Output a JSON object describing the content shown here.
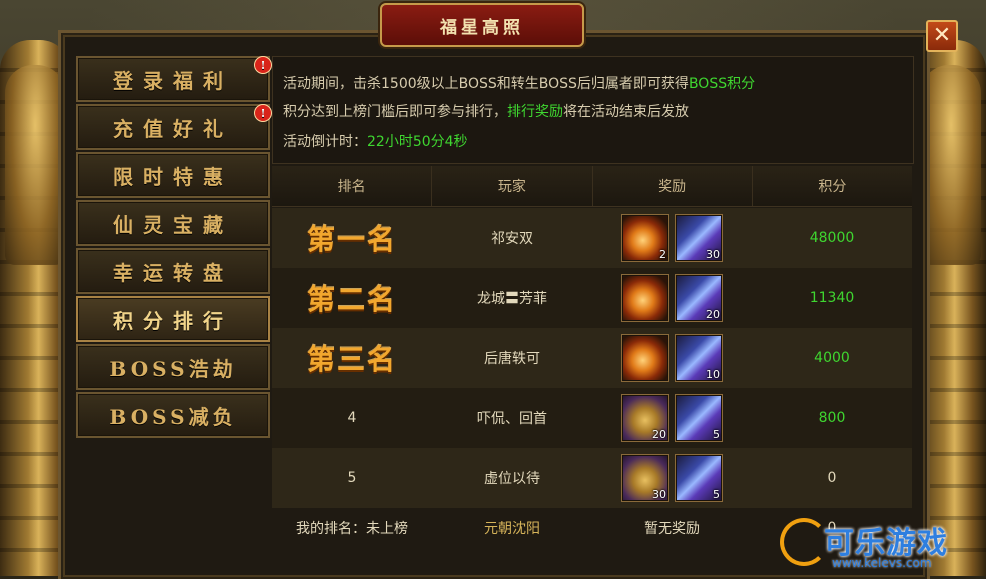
{
  "window": {
    "title": "福星高照",
    "close_icon": "✕"
  },
  "sidebar": {
    "items": [
      {
        "label": "登录福利",
        "badge": "!",
        "active": false
      },
      {
        "label": "充值好礼",
        "badge": "!",
        "active": false
      },
      {
        "label": "限时特惠",
        "badge": "",
        "active": false
      },
      {
        "label": "仙灵宝藏",
        "badge": "",
        "active": false
      },
      {
        "label": "幸运转盘",
        "badge": "",
        "active": false
      },
      {
        "label": "积分排行",
        "badge": "",
        "active": true
      },
      {
        "label": "BOSS浩劫",
        "badge": "",
        "active": false
      },
      {
        "label": "BOSS减负",
        "badge": "",
        "active": false
      }
    ]
  },
  "info": {
    "line1_prefix": "活动期间，击杀1500级以上BOSS和转生BOSS后归属者即可获得",
    "line1_highlight": "BOSS积分",
    "line2_prefix": "积分达到上榜门槛后即可参与排行，",
    "line2_highlight": "排行奖励",
    "line2_suffix": "将在活动结束后发放",
    "countdown_label": "活动倒计时：",
    "countdown_value": "22小时50分4秒"
  },
  "table": {
    "headers": [
      "排名",
      "玩家",
      "奖励",
      "积分"
    ],
    "rows": [
      {
        "rank": "第一名",
        "player": "祁安双",
        "rewards": [
          {
            "type": "potion",
            "qty": "2"
          },
          {
            "type": "shard",
            "qty": "30"
          }
        ],
        "score": "48000"
      },
      {
        "rank": "第二名",
        "player": "龙城〓芳菲",
        "rewards": [
          {
            "type": "potion",
            "qty": ""
          },
          {
            "type": "shard",
            "qty": "20"
          }
        ],
        "score": "11340"
      },
      {
        "rank": "第三名",
        "player": "后唐轶可",
        "rewards": [
          {
            "type": "potion",
            "qty": ""
          },
          {
            "type": "shard",
            "qty": "10"
          }
        ],
        "score": "4000"
      },
      {
        "rank": "4",
        "player": "吓侃、回首",
        "rewards": [
          {
            "type": "chest",
            "qty": "20"
          },
          {
            "type": "shard",
            "qty": "5"
          }
        ],
        "score": "800"
      },
      {
        "rank": "5",
        "player": "虚位以待",
        "rewards": [
          {
            "type": "chest",
            "qty": "30"
          },
          {
            "type": "shard",
            "qty": "5"
          }
        ],
        "score": "0"
      }
    ]
  },
  "footer": {
    "my_rank": "我的排名：未上榜",
    "server": "元朝沈阳",
    "my_reward": "暂无奖励",
    "my_score": "0"
  },
  "watermark": {
    "name": "可乐游戏",
    "url": "www.kelevs.com"
  },
  "colors": {
    "highlight_green": "#3fd630",
    "rank_gold": "#f2a72e",
    "title_red": "#8a1c12"
  }
}
